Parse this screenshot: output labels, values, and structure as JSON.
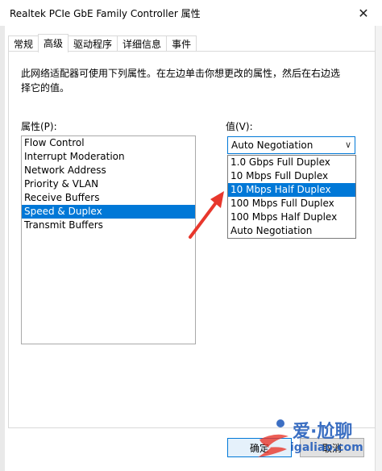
{
  "window": {
    "title": "Realtek PCIe GbE Family Controller 属性",
    "close_glyph": "✕"
  },
  "tabs": [
    {
      "label": "常规",
      "active": false
    },
    {
      "label": "高级",
      "active": true
    },
    {
      "label": "驱动程序",
      "active": false
    },
    {
      "label": "详细信息",
      "active": false
    },
    {
      "label": "事件",
      "active": false
    }
  ],
  "description": "此网络适配器可使用下列属性。在左边单击你想更改的属性，然后在右边选择它的值。",
  "property": {
    "label": "属性(P):",
    "items": [
      {
        "label": "Flow Control",
        "selected": false
      },
      {
        "label": "Interrupt Moderation",
        "selected": false
      },
      {
        "label": "Network Address",
        "selected": false
      },
      {
        "label": "Priority & VLAN",
        "selected": false
      },
      {
        "label": "Receive Buffers",
        "selected": false
      },
      {
        "label": "Speed & Duplex",
        "selected": true
      },
      {
        "label": "Transmit Buffers",
        "selected": false
      }
    ]
  },
  "value": {
    "label": "值(V):",
    "current": "Auto Negotiation",
    "options": [
      {
        "label": "1.0 Gbps Full Duplex",
        "selected": false
      },
      {
        "label": "10 Mbps Full Duplex",
        "selected": false
      },
      {
        "label": "10 Mbps Half Duplex",
        "selected": true
      },
      {
        "label": "100 Mbps Full Duplex",
        "selected": false
      },
      {
        "label": "100 Mbps Half Duplex",
        "selected": false
      },
      {
        "label": "Auto Negotiation",
        "selected": false
      }
    ]
  },
  "buttons": {
    "ok": "确定",
    "cancel": "取消"
  },
  "watermark": {
    "line1": "爱·尬聊",
    "line2": "igaliao.com"
  },
  "colors": {
    "accent": "#0078d7",
    "annotation_arrow": "#e8372c",
    "watermark": "#1a56b8"
  }
}
